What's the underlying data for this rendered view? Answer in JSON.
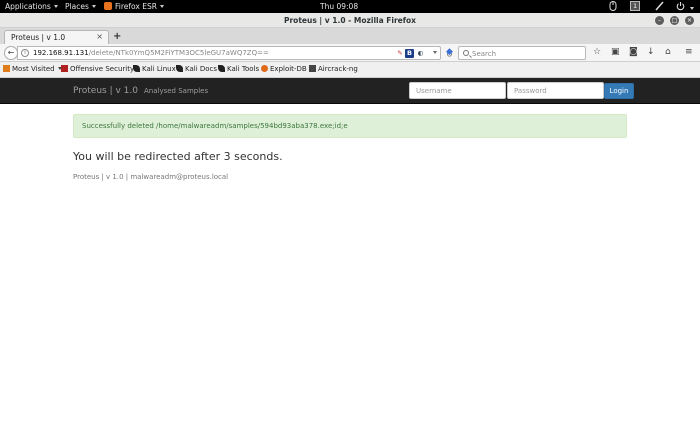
{
  "topbar": {
    "applications": "Applications",
    "places": "Places",
    "app_name": "Firefox ESR",
    "clock": "Thu 09:08",
    "workspace": "1"
  },
  "window": {
    "title": "Proteus | v 1.0 - Mozilla Firefox"
  },
  "tabs": [
    {
      "label": "Proteus | v 1.0"
    }
  ],
  "navbar": {
    "url_host": "192.168.91.131",
    "url_path": "/delete/NTk0YmQ5M2FiYTM3OC5leGU7aWQ7ZQ==",
    "search_placeholder": "Search"
  },
  "bookmarks": [
    {
      "label": "Most Visited",
      "icon": "folder-icon",
      "color": "#e07b1a"
    },
    {
      "label": "Offensive Security",
      "icon": "offsec-icon",
      "color": "#b02020"
    },
    {
      "label": "Kali Linux",
      "icon": "kali-dragon-icon",
      "color": "#222222"
    },
    {
      "label": "Kali Docs",
      "icon": "kali-dragon-icon",
      "color": "#222222"
    },
    {
      "label": "Kali Tools",
      "icon": "kali-dragon-icon",
      "color": "#222222"
    },
    {
      "label": "Exploit-DB",
      "icon": "exploitdb-icon",
      "color": "#e06a1a"
    },
    {
      "label": "Aircrack-ng",
      "icon": "aircrack-icon",
      "color": "#444444"
    }
  ],
  "app": {
    "brand": "Proteus | v 1.0",
    "nav_link": "Analysed Samples",
    "username_placeholder": "Username",
    "password_placeholder": "Password",
    "login_label": "Login",
    "alert_text": "Successfully deleted /home/malwareadm/samples/594bd93aba378.exe;id;e",
    "redirect_text": "You will be redirected after 3 seconds.",
    "footer_text": "Proteus | v 1.0 | malwareadm@proteus.local"
  },
  "colors": {
    "app_navbar": "#222222",
    "login_button": "#337ab7",
    "alert_bg": "#dff0d8",
    "alert_text": "#3c763d"
  }
}
